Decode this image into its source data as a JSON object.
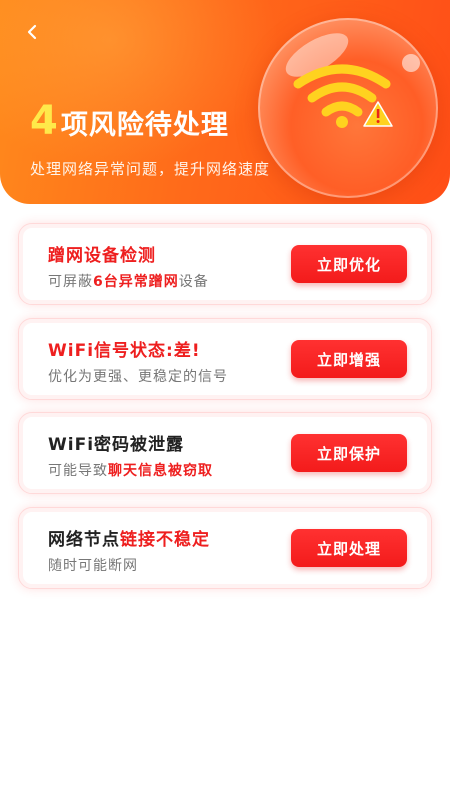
{
  "header": {
    "back_icon": "chevron-left-icon",
    "risk_count": "4",
    "title_rest": "项风险待处理",
    "subtitle": "处理网络异常问题，提升网络速度",
    "illustration_icon": "wifi-warning-icon"
  },
  "colors": {
    "header_start": "#ff8a1c",
    "header_end": "#ff4e17",
    "count_yellow": "#ffe94a",
    "accent_red": "#ee1f1f",
    "button_red": "#f31b1b",
    "card_border": "#ffd9d9"
  },
  "items": [
    {
      "title_red": "蹭网设备检测",
      "title_dark": "",
      "desc_prefix": "可屏蔽",
      "desc_highlight": "6台异常蹭网",
      "desc_suffix": "设备",
      "button": "立即优化"
    },
    {
      "title_red": "WiFi信号状态:差!",
      "title_dark": "",
      "desc_prefix": "优化为更强、更稳定的信号",
      "desc_highlight": "",
      "desc_suffix": "",
      "button": "立即增强"
    },
    {
      "title_red": "",
      "title_dark": "WiFi密码被泄露",
      "desc_prefix": "可能导致",
      "desc_highlight": "聊天信息被窃取",
      "desc_suffix": "",
      "button": "立即保护"
    },
    {
      "title_dark_prefix": "网络节点",
      "title_red": "链接不稳定",
      "desc_prefix": "随时可能断网",
      "desc_highlight": "",
      "desc_suffix": "",
      "button": "立即处理"
    }
  ]
}
